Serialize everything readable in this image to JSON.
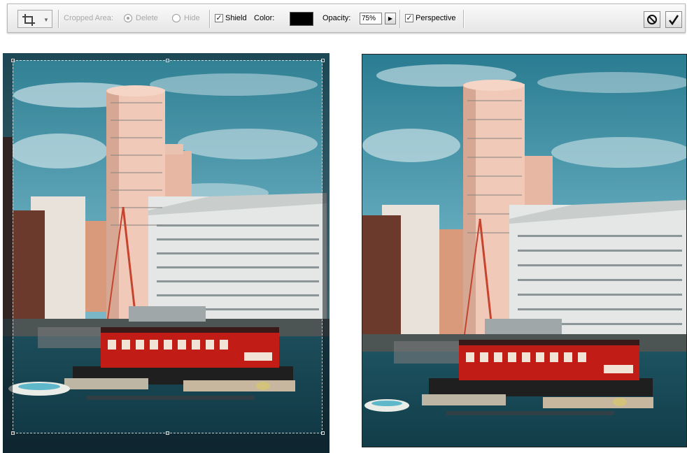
{
  "toolbar": {
    "tool_icon": "crop-tool-icon",
    "cropped_area_label": "Cropped Area:",
    "delete_label": "Delete",
    "hide_label": "Hide",
    "shield_label": "Shield",
    "color_label": "Color:",
    "shield_color": "#000000",
    "opacity_label": "Opacity:",
    "opacity_value": "75%",
    "perspective_label": "Perspective",
    "cancel_icon": "cancel-icon",
    "commit_icon": "checkmark-icon",
    "shield_checked": true,
    "perspective_checked": true,
    "delete_selected": true
  },
  "panes": {
    "left": "crop-preview-with-shield",
    "right": "cropped-result"
  }
}
